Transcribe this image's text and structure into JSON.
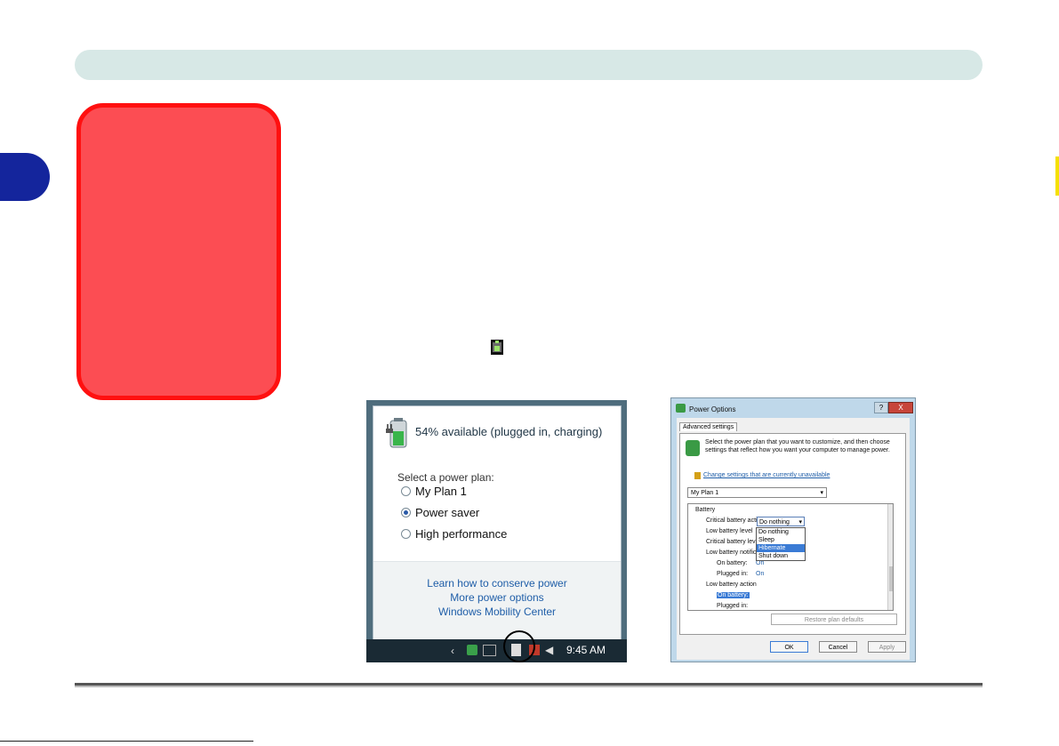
{
  "popup": {
    "status": "54% available (plugged in, charging)",
    "select_label": "Select a power plan:",
    "plans": [
      {
        "label": "My Plan 1",
        "checked": false
      },
      {
        "label": "Power saver",
        "checked": true
      },
      {
        "label": "High performance",
        "checked": false
      }
    ],
    "links": [
      "Learn how to conserve power",
      "More power options",
      "Windows Mobility Center"
    ],
    "clock": "9:45 AM"
  },
  "power_options": {
    "title": "Power Options",
    "help": "?",
    "close": "X",
    "tab": "Advanced settings",
    "description": "Select the power plan that you want to customize, and then choose settings that reflect how you want your computer to manage power.",
    "change_link": "Change settings that are currently unavailable",
    "plan": "My Plan 1",
    "tree": {
      "battery": "Battery",
      "critical_action": "Critical battery action",
      "low_level": "Low battery level",
      "critical_level": "Critical battery level",
      "low_notification": "Low battery notification",
      "on_battery_label": "On battery:",
      "on_battery_value": "On",
      "plugged_in_label": "Plugged in:",
      "plugged_in_value": "On",
      "low_action": "Low battery action",
      "action_on_battery": "On battery:",
      "action_plugged_in": "Plugged in:"
    },
    "dropdown_value": "Do nothing",
    "dropdown_options": [
      "Do nothing",
      "Sleep",
      "Hibernate",
      "Shut down"
    ],
    "restore": "Restore plan defaults",
    "ok": "OK",
    "cancel": "Cancel",
    "apply": "Apply"
  }
}
